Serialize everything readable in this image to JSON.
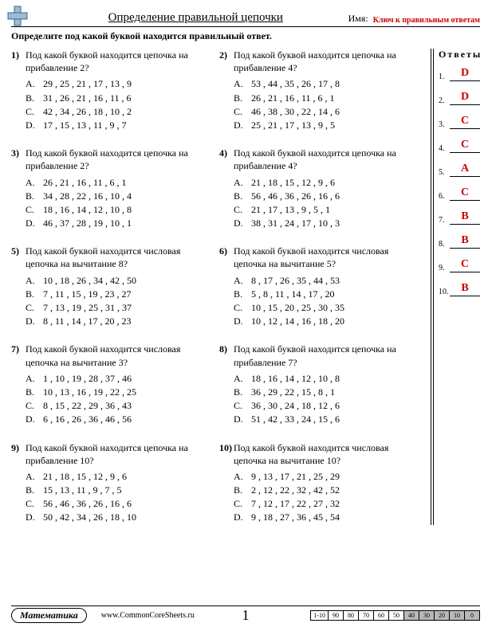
{
  "header": {
    "title": "Определение правильной цепочки",
    "name_label": "Имя:",
    "key_label": "Ключ к правильным ответам"
  },
  "instructions": "Определите под какой буквой находится правильный ответ.",
  "answers_title": "Ответы",
  "problems": [
    {
      "n": "1)",
      "q": "Под какой буквой находится цепочка на прибавление 2?",
      "c": [
        {
          "l": "A.",
          "t": "29 , 25 , 21 , 17 , 13 , 9"
        },
        {
          "l": "B.",
          "t": "31 , 26 , 21 , 16 , 11 , 6"
        },
        {
          "l": "C.",
          "t": "42 , 34 , 26 , 18 , 10 , 2"
        },
        {
          "l": "D.",
          "t": "17 , 15 , 13 , 11 , 9 , 7"
        }
      ]
    },
    {
      "n": "2)",
      "q": "Под какой буквой находится цепочка на прибавление 4?",
      "c": [
        {
          "l": "A.",
          "t": "53 , 44 , 35 , 26 , 17 , 8"
        },
        {
          "l": "B.",
          "t": "26 , 21 , 16 , 11 , 6 , 1"
        },
        {
          "l": "C.",
          "t": "46 , 38 , 30 , 22 , 14 , 6"
        },
        {
          "l": "D.",
          "t": "25 , 21 , 17 , 13 , 9 , 5"
        }
      ]
    },
    {
      "n": "3)",
      "q": "Под какой буквой находится цепочка на прибавление 2?",
      "c": [
        {
          "l": "A.",
          "t": "26 , 21 , 16 , 11 , 6 , 1"
        },
        {
          "l": "B.",
          "t": "34 , 28 , 22 , 16 , 10 , 4"
        },
        {
          "l": "C.",
          "t": "18 , 16 , 14 , 12 , 10 , 8"
        },
        {
          "l": "D.",
          "t": "46 , 37 , 28 , 19 , 10 , 1"
        }
      ]
    },
    {
      "n": "4)",
      "q": "Под какой буквой находится цепочка на прибавление 4?",
      "c": [
        {
          "l": "A.",
          "t": "21 , 18 , 15 , 12 , 9 , 6"
        },
        {
          "l": "B.",
          "t": "56 , 46 , 36 , 26 , 16 , 6"
        },
        {
          "l": "C.",
          "t": "21 , 17 , 13 , 9 , 5 , 1"
        },
        {
          "l": "D.",
          "t": "38 , 31 , 24 , 17 , 10 , 3"
        }
      ]
    },
    {
      "n": "5)",
      "q": "Под какой буквой находится числовая цепочка на вычитание 8?",
      "c": [
        {
          "l": "A.",
          "t": "10 , 18 , 26 , 34 , 42 , 50"
        },
        {
          "l": "B.",
          "t": "7 , 11 , 15 , 19 , 23 , 27"
        },
        {
          "l": "C.",
          "t": "7 , 13 , 19 , 25 , 31 , 37"
        },
        {
          "l": "D.",
          "t": "8 , 11 , 14 , 17 , 20 , 23"
        }
      ]
    },
    {
      "n": "6)",
      "q": "Под какой буквой находится числовая цепочка на вычитание 5?",
      "c": [
        {
          "l": "A.",
          "t": "8 , 17 , 26 , 35 , 44 , 53"
        },
        {
          "l": "B.",
          "t": "5 , 8 , 11 , 14 , 17 , 20"
        },
        {
          "l": "C.",
          "t": "10 , 15 , 20 , 25 , 30 , 35"
        },
        {
          "l": "D.",
          "t": "10 , 12 , 14 , 16 , 18 , 20"
        }
      ]
    },
    {
      "n": "7)",
      "q": "Под какой буквой находится числовая цепочка на вычитание 3?",
      "c": [
        {
          "l": "A.",
          "t": "1 , 10 , 19 , 28 , 37 , 46"
        },
        {
          "l": "B.",
          "t": "10 , 13 , 16 , 19 , 22 , 25"
        },
        {
          "l": "C.",
          "t": "8 , 15 , 22 , 29 , 36 , 43"
        },
        {
          "l": "D.",
          "t": "6 , 16 , 26 , 36 , 46 , 56"
        }
      ]
    },
    {
      "n": "8)",
      "q": "Под какой буквой находится цепочка на прибавление 7?",
      "c": [
        {
          "l": "A.",
          "t": "18 , 16 , 14 , 12 , 10 , 8"
        },
        {
          "l": "B.",
          "t": "36 , 29 , 22 , 15 , 8 , 1"
        },
        {
          "l": "C.",
          "t": "36 , 30 , 24 , 18 , 12 , 6"
        },
        {
          "l": "D.",
          "t": "51 , 42 , 33 , 24 , 15 , 6"
        }
      ]
    },
    {
      "n": "9)",
      "q": "Под какой буквой находится цепочка на прибавление 10?",
      "c": [
        {
          "l": "A.",
          "t": "21 , 18 , 15 , 12 , 9 , 6"
        },
        {
          "l": "B.",
          "t": "15 , 13 , 11 , 9 , 7 , 5"
        },
        {
          "l": "C.",
          "t": "56 , 46 , 36 , 26 , 16 , 6"
        },
        {
          "l": "D.",
          "t": "50 , 42 , 34 , 26 , 18 , 10"
        }
      ]
    },
    {
      "n": "10)",
      "q": "Под какой буквой находится числовая цепочка на вычитание 10?",
      "c": [
        {
          "l": "A.",
          "t": "9 , 13 , 17 , 21 , 25 , 29"
        },
        {
          "l": "B.",
          "t": "2 , 12 , 22 , 32 , 42 , 52"
        },
        {
          "l": "C.",
          "t": "7 , 12 , 17 , 22 , 27 , 32"
        },
        {
          "l": "D.",
          "t": "9 , 18 , 27 , 36 , 45 , 54"
        }
      ]
    }
  ],
  "answers": [
    {
      "i": "1.",
      "v": "D"
    },
    {
      "i": "2.",
      "v": "D"
    },
    {
      "i": "3.",
      "v": "C"
    },
    {
      "i": "4.",
      "v": "C"
    },
    {
      "i": "5.",
      "v": "A"
    },
    {
      "i": "6.",
      "v": "C"
    },
    {
      "i": "7.",
      "v": "B"
    },
    {
      "i": "8.",
      "v": "B"
    },
    {
      "i": "9.",
      "v": "C"
    },
    {
      "i": "10.",
      "v": "B"
    }
  ],
  "footer": {
    "subject": "Математика",
    "site": "www.CommonCoreSheets.ru",
    "page": "1",
    "score_label": "1-10",
    "scores": [
      "90",
      "80",
      "70",
      "60",
      "50",
      "40",
      "30",
      "20",
      "10",
      "0"
    ],
    "shaded_from": 5
  }
}
